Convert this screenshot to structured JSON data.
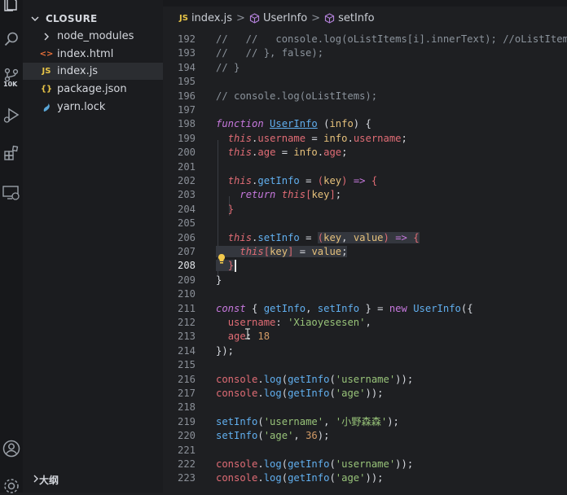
{
  "explorer": {
    "root": "CLOSURE",
    "items": [
      {
        "label": "node_modules",
        "kind": "folder"
      },
      {
        "label": "index.html",
        "kind": "html"
      },
      {
        "label": "index.js",
        "kind": "js",
        "selected": true
      },
      {
        "label": "package.json",
        "kind": "json"
      },
      {
        "label": "yarn.lock",
        "kind": "lock"
      }
    ],
    "outline_label": "大纲"
  },
  "activity": {
    "scm_badge": "10K"
  },
  "breadcrumb": {
    "file": "index.js",
    "symbol1": "UserInfo",
    "symbol2": "setInfo"
  },
  "colors": {
    "keyword": "#c678dd",
    "function": "#61afef",
    "variable": "#e06c75",
    "string": "#98c379",
    "number": "#d19a66",
    "comment": "#8b939c"
  },
  "code": {
    "line_numbers": [
      "192",
      "193",
      "194",
      "195",
      "196",
      "197",
      "198",
      "199",
      "200",
      "201",
      "202",
      "203",
      "204",
      "205",
      "206",
      "207",
      "208",
      "209",
      "210",
      "211",
      "212",
      "213",
      "214",
      "215",
      "216",
      "217",
      "218",
      "219",
      "220",
      "221",
      "222",
      "223"
    ],
    "current_line": "208"
  }
}
